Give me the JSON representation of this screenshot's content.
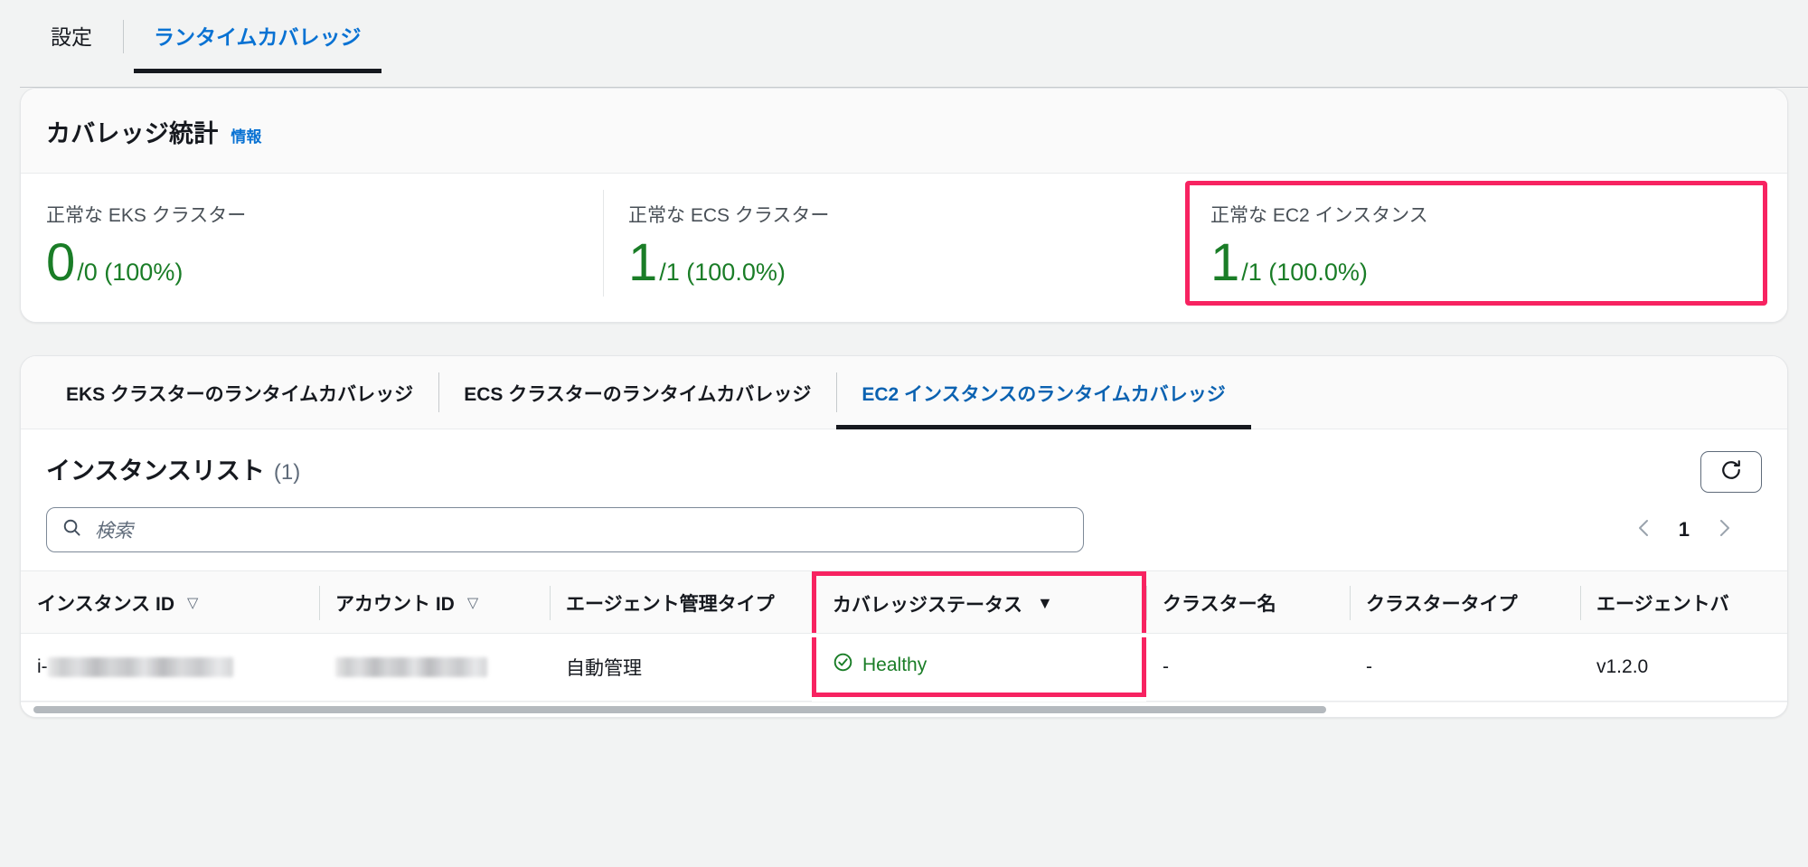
{
  "top_tabs": [
    {
      "label": "設定",
      "active": false
    },
    {
      "label": "ランタイムカバレッジ",
      "active": true
    }
  ],
  "coverage_stats": {
    "title": "カバレッジ統計",
    "info_label": "情報",
    "accent_highlight": "#f72361",
    "value_color": "#1a7d27",
    "items": [
      {
        "label": "正常な EKS クラスター",
        "big": "0",
        "small": "/0 (100%)",
        "highlighted": false
      },
      {
        "label": "正常な ECS クラスター",
        "big": "1",
        "small": "/1 (100.0%)",
        "highlighted": false
      },
      {
        "label": "正常な EC2 インスタンス",
        "big": "1",
        "small": "/1 (100.0%)",
        "highlighted": true
      }
    ]
  },
  "sub_tabs": [
    {
      "label": "EKS クラスターのランタイムカバレッジ",
      "active": false
    },
    {
      "label": "ECS クラスターのランタイムカバレッジ",
      "active": false
    },
    {
      "label": "EC2 インスタンスのランタイムカバレッジ",
      "active": true
    }
  ],
  "instance_list": {
    "title": "インスタンスリスト",
    "count": "(1)",
    "refresh_icon": "refresh-icon",
    "search": {
      "icon": "search-icon",
      "placeholder": "検索",
      "value": ""
    },
    "pagination": {
      "prev_icon": "chevron-left-icon",
      "page": "1",
      "next_icon": "chevron-right-icon"
    },
    "columns": [
      {
        "label": "インスタンス ID",
        "sort": "sortable",
        "highlighted": false
      },
      {
        "label": "アカウント ID",
        "sort": "sortable",
        "highlighted": false
      },
      {
        "label": "エージェント管理タイプ",
        "sort": "none",
        "highlighted": false
      },
      {
        "label": "カバレッジステータス",
        "sort": "desc",
        "highlighted": true
      },
      {
        "label": "クラスター名",
        "sort": "none",
        "highlighted": false
      },
      {
        "label": "クラスタータイプ",
        "sort": "none",
        "highlighted": false
      },
      {
        "label": "エージェントバ",
        "sort": "none",
        "highlighted": false
      }
    ],
    "rows": [
      {
        "instance_id_prefix": "i-",
        "instance_id_redacted": true,
        "account_id_redacted": true,
        "agent_management_type": "自動管理",
        "coverage_status": "Healthy",
        "coverage_status_icon": "check-circle-icon",
        "cluster_name": "-",
        "cluster_type": "-",
        "agent_version": "v1.2.0"
      }
    ]
  }
}
